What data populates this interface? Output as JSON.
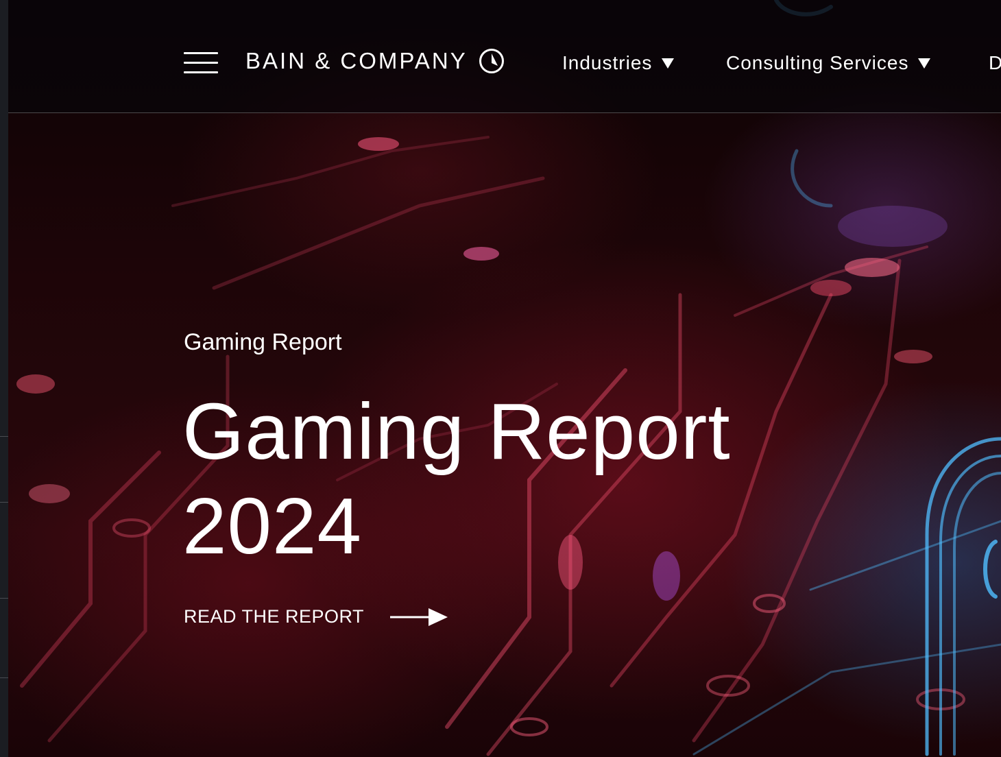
{
  "header": {
    "brand": "BAIN & COMPANY",
    "nav": [
      {
        "label": "Industries"
      },
      {
        "label": "Consulting Services"
      },
      {
        "label": "D"
      }
    ]
  },
  "hero": {
    "eyebrow": "Gaming Report",
    "headline_line1": "Gaming Report",
    "headline_line2": "2024",
    "cta_label": "READ THE REPORT"
  },
  "icons": {
    "menu": "hamburger-menu-icon",
    "logo": "compass-logo-icon",
    "caret": "caret-down-icon",
    "cta": "arrow-right-icon"
  },
  "colors": {
    "text": "#ffffff",
    "background": "#1d0508",
    "accent_red": "#e0304f",
    "accent_blue": "#3fa9f5"
  }
}
